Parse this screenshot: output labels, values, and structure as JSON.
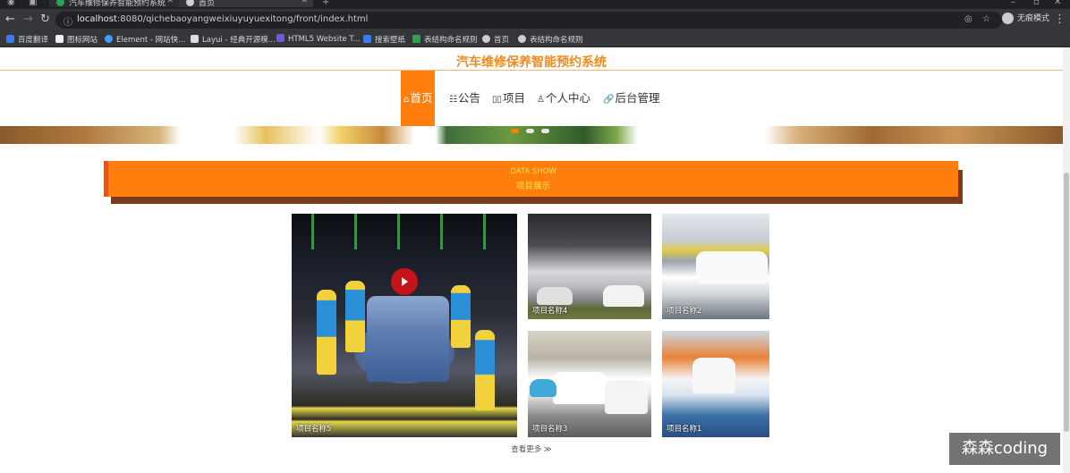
{
  "browser": {
    "tabs": [
      {
        "title": "汽车维修保养智能预约系统"
      },
      {
        "title": "首页"
      }
    ],
    "url": {
      "host": "localhost",
      "rest": ":8080/qichebaoyangweixiuyuyuexitong/front/index.html"
    },
    "profile_label": "无痕模式",
    "bookmarks": [
      {
        "label": "百度翻译",
        "color": "#3b7bea"
      },
      {
        "label": "图标网站",
        "color": "#eeeeee"
      },
      {
        "label": "Element - 网站快...",
        "color": "#409eff"
      },
      {
        "label": "Layui - 经典开源模...",
        "color": "#dddddd"
      },
      {
        "label": "HTML5 Website T...",
        "color": "#6f5bd8"
      },
      {
        "label": "搜索壁纸",
        "color": "#3b7bea"
      },
      {
        "label": "表结构命名规则",
        "color": "#2aa44f"
      },
      {
        "label": "首页",
        "color": "#cccccc"
      },
      {
        "label": "表结构命名规则",
        "color": "#cccccc"
      }
    ]
  },
  "site": {
    "title": "汽车维修保养智能预约系统",
    "accent_color": "#ff7e0d",
    "nav": [
      {
        "icon": "home-icon",
        "label": "首页",
        "active": true
      },
      {
        "icon": "notice-icon",
        "label": "公告"
      },
      {
        "icon": "project-icon",
        "label": "项目"
      },
      {
        "icon": "user-icon",
        "label": "个人中心"
      },
      {
        "icon": "link-icon",
        "label": "后台管理"
      }
    ]
  },
  "section": {
    "title_en": "DATA SHOW",
    "title_cn": "项目展示"
  },
  "cards": [
    {
      "label": "项目名称5"
    },
    {
      "label": "项目名称4"
    },
    {
      "label": "项目名称2"
    },
    {
      "label": "项目名称3"
    },
    {
      "label": "项目名称1"
    }
  ],
  "more_link": "查看更多 ≫",
  "watermark": "森森coding"
}
